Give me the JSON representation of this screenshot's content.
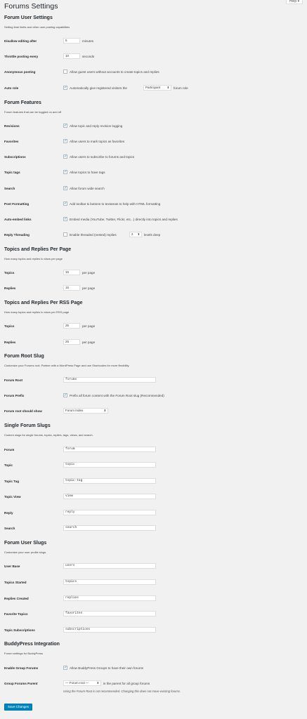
{
  "help_tab": "Help ▾",
  "page_title": "Forums Settings",
  "user_settings": {
    "heading": "Forum User Settings",
    "description": "Setting time limits and other user posting capabilities",
    "disallow_label": "Disallow editing after",
    "disallow_value": "5",
    "disallow_unit": "minutes",
    "throttle_label": "Throttle posting every",
    "throttle_value": "10",
    "throttle_unit": "seconds",
    "anon_label": "Anonymous posting",
    "anon_text": "Allow guest users without accounts to create topics and replies",
    "autorole_label": "Auto role",
    "autorole_text": "Automatically give registered visitors the",
    "autorole_select": "Participant",
    "autorole_suffix": "forum role"
  },
  "features": {
    "heading": "Forum Features",
    "description": "Forum features that can be toggled on and off",
    "rows": [
      {
        "label": "Revisions",
        "text": "Allow topic and reply revision logging"
      },
      {
        "label": "Favorites",
        "text": "Allow users to mark topics as favorites"
      },
      {
        "label": "Subscriptions",
        "text": "Allow users to subscribe to forums and topics"
      },
      {
        "label": "Topic tags",
        "text": "Allow topics to have tags"
      },
      {
        "label": "Search",
        "text": "Allow forum wide search"
      },
      {
        "label": "Post Formatting",
        "text": "Add toolbar & buttons to textareas to help with HTML formatting"
      },
      {
        "label": "Auto-embed links",
        "text": "Embed media (YouTube, Twitter, Flickr, etc...) directly into topics and replies"
      }
    ],
    "threading_label": "Reply Threading",
    "threading_text": "Enable threaded (nested) replies",
    "threading_select": "2",
    "threading_suffix": "levels deep"
  },
  "per_page": {
    "heading": "Topics and Replies Per Page",
    "description": "How many topics and replies to show per page",
    "topics_label": "Topics",
    "topics_value": "15",
    "topics_unit": "per page",
    "replies_label": "Replies",
    "replies_value": "15",
    "replies_unit": "per page"
  },
  "rss": {
    "heading": "Topics and Replies Per RSS Page",
    "description": "How many topics and replies to show per RSS page",
    "topics_label": "Topics",
    "topics_value": "25",
    "topics_unit": "per page",
    "replies_label": "Replies",
    "replies_value": "25",
    "replies_unit": "per page"
  },
  "root_slug": {
    "heading": "Forum Root Slug",
    "description": "Customize your Forums root. Partner with a WordPress Page and use Shortcodes for more flexibility.",
    "root_label": "Forum Root",
    "root_value": "forums",
    "prefix_label": "Forum Prefix",
    "prefix_text": "Prefix all forum content with the Forum Root slug (Recommended)",
    "show_label": "Forum root should show",
    "show_select": "Forum Index"
  },
  "single_slugs": {
    "heading": "Single Forum Slugs",
    "description": "Custom slugs for single forums, topics, replies, tags, views, and search.",
    "rows": [
      {
        "label": "Forum",
        "value": "forum"
      },
      {
        "label": "Topic",
        "value": "topic"
      },
      {
        "label": "Topic Tag",
        "value": "topic-tag"
      },
      {
        "label": "Topic View",
        "value": "view"
      },
      {
        "label": "Reply",
        "value": "reply"
      },
      {
        "label": "Search",
        "value": "search"
      }
    ]
  },
  "user_slugs": {
    "heading": "Forum User Slugs",
    "description": "Customize your user profile slugs.",
    "rows": [
      {
        "label": "User Base",
        "value": "users"
      },
      {
        "label": "Topics Started",
        "value": "topics"
      },
      {
        "label": "Replies Created",
        "value": "replies"
      },
      {
        "label": "Favorite Topics",
        "value": "favorites"
      },
      {
        "label": "Topic Subscriptions",
        "value": "subscriptions"
      }
    ]
  },
  "buddypress": {
    "heading": "BuddyPress Integration",
    "description": "Forum settings for BuddyPress",
    "groups_label": "Enable Group Forums",
    "groups_text": "Allow BuddyPress Groups to have their own forums",
    "parent_label": "Group Forums Parent",
    "parent_select": "— Forum root —",
    "parent_suffix": "is the parent for all group forums",
    "parent_note": "Using the Forum Root is not recommended. Changing this does not move existing forums."
  },
  "save_button": "Save Changes"
}
